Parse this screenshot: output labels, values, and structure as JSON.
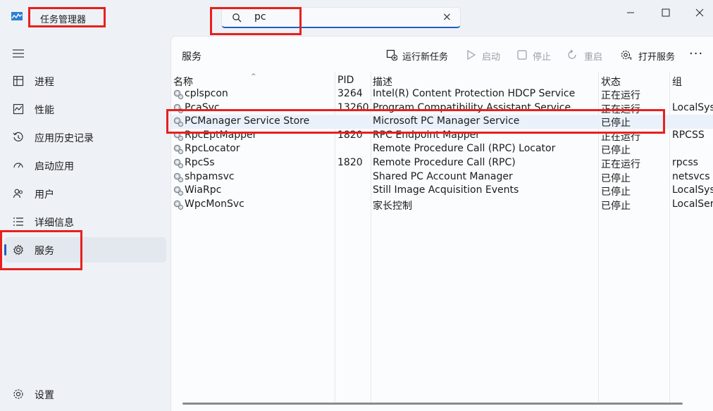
{
  "app": {
    "title": "任务管理器",
    "icon": "task-manager-icon"
  },
  "search": {
    "value": "pc",
    "icon": "search-icon",
    "clear_icon": "×"
  },
  "window_controls": {
    "minimize": "minimize-icon",
    "maximize": "maximize-icon",
    "close": "close-icon"
  },
  "sidebar": {
    "items": [
      {
        "label": "进程",
        "icon": "processes-icon"
      },
      {
        "label": "性能",
        "icon": "performance-icon"
      },
      {
        "label": "应用历史记录",
        "icon": "history-icon"
      },
      {
        "label": "启动应用",
        "icon": "startup-icon"
      },
      {
        "label": "用户",
        "icon": "users-icon"
      },
      {
        "label": "详细信息",
        "icon": "details-icon"
      },
      {
        "label": "服务",
        "icon": "services-icon",
        "active": true
      }
    ],
    "settings": {
      "label": "设置",
      "icon": "gear-icon"
    }
  },
  "main": {
    "title": "服务",
    "toolbar": {
      "new_task": "运行新任务",
      "start": "启动",
      "stop": "停止",
      "restart": "重启",
      "open_services": "打开服务",
      "more": "···"
    },
    "columns": {
      "name": "名称",
      "pid": "PID",
      "description": "描述",
      "status": "状态",
      "group": "组"
    },
    "rows": [
      {
        "name": "cplspcon",
        "pid": "3264",
        "description": "Intel(R) Content Protection HDCP Service",
        "status": "正在运行",
        "group": ""
      },
      {
        "name": "PcaSvc",
        "pid": "13260",
        "description": "Program Compatibility Assistant Service",
        "status": "正在运行",
        "group": "LocalSystemNetworkRestricted"
      },
      {
        "name": "PCManager Service Store",
        "pid": "",
        "description": "Microsoft PC Manager Service",
        "status": "已停止",
        "group": "",
        "selected": true
      },
      {
        "name": "RpcEptMapper",
        "pid": "1820",
        "description": "RPC Endpoint Mapper",
        "status": "正在运行",
        "group": "RPCSS"
      },
      {
        "name": "RpcLocator",
        "pid": "",
        "description": "Remote Procedure Call (RPC) Locator",
        "status": "已停止",
        "group": ""
      },
      {
        "name": "RpcSs",
        "pid": "1820",
        "description": "Remote Procedure Call (RPC)",
        "status": "正在运行",
        "group": "rpcss"
      },
      {
        "name": "shpamsvc",
        "pid": "",
        "description": "Shared PC Account Manager",
        "status": "已停止",
        "group": "netsvcs"
      },
      {
        "name": "WiaRpc",
        "pid": "",
        "description": "Still Image Acquisition Events",
        "status": "已停止",
        "group": "LocalSystemNetworkRestricted"
      },
      {
        "name": "WpcMonSvc",
        "pid": "",
        "description": "家长控制",
        "status": "已停止",
        "group": "LocalService"
      }
    ]
  },
  "colors": {
    "accent": "#1f5fbf",
    "annotation": "#e8201c",
    "selected_row": "#eaf1fb",
    "background": "#eef2f7"
  }
}
